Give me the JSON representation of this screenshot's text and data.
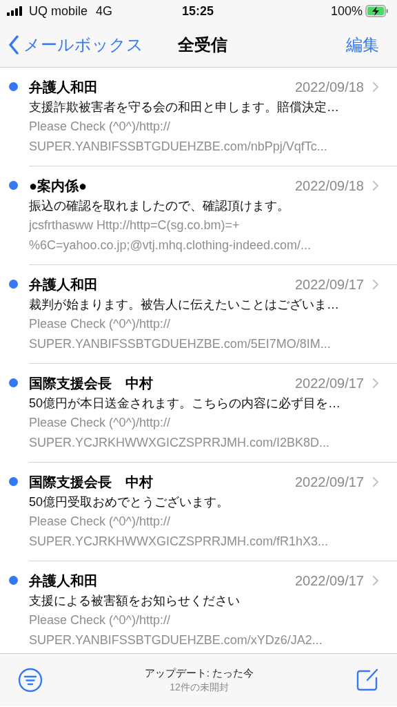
{
  "status_bar": {
    "carrier": "UQ mobile",
    "network": "4G",
    "time": "15:25",
    "battery": "100%"
  },
  "nav": {
    "back": "メールボックス",
    "title": "全受信",
    "edit": "編集"
  },
  "messages": [
    {
      "sender": "弁護人和田",
      "date": "2022/09/18",
      "subject": "支援詐欺被害者を守る会の和田と申します。賠償決定…",
      "preview": [
        "Please Check (^0^)/http://",
        "SUPER.YANBIFSSBTGDUEHZBE.com/nbPpj/VqfTc..."
      ],
      "unread": true
    },
    {
      "sender": "●案内係●",
      "date": "2022/09/18",
      "subject": "振込の確認を取れましたので、確認頂けます。",
      "preview": [
        "jcsfrthasww Http://http=C(sg.co.bm)=+",
        "%6C=yahoo.co.jp;@vtj.mhq.clothing-indeed.com/..."
      ],
      "unread": true
    },
    {
      "sender": "弁護人和田",
      "date": "2022/09/17",
      "subject": "裁判が始まります。被告人に伝えたいことはございま…",
      "preview": [
        "Please Check (^0^)/http://",
        "SUPER.YANBIFSSBTGDUEHZBE.com/5EI7MO/8IM..."
      ],
      "unread": true
    },
    {
      "sender": "国際支援会長　中村",
      "date": "2022/09/17",
      "subject": "50億円が本日送金されます。こちらの内容に必ず目を…",
      "preview": [
        "Please Check (^0^)/http://",
        "SUPER.YCJRKHWWXGICZSPRRJMH.com/I2BK8D..."
      ],
      "unread": true
    },
    {
      "sender": "国際支援会長　中村",
      "date": "2022/09/17",
      "subject": "50億円受取おめでとうございます。",
      "preview": [
        "Please Check (^0^)/http://",
        "SUPER.YCJRKHWWXGICZSPRRJMH.com/fR1hX3..."
      ],
      "unread": true
    },
    {
      "sender": "弁護人和田",
      "date": "2022/09/17",
      "subject": "支援による被害額をお知らせください",
      "preview": [
        "Please Check (^0^)/http://",
        "SUPER.YANBIFSSBTGDUEHZBE.com/xYDz6/JA2..."
      ],
      "unread": true
    }
  ],
  "toolbar": {
    "updated": "アップデート: たった今",
    "unread_count": "12件の未開封"
  }
}
